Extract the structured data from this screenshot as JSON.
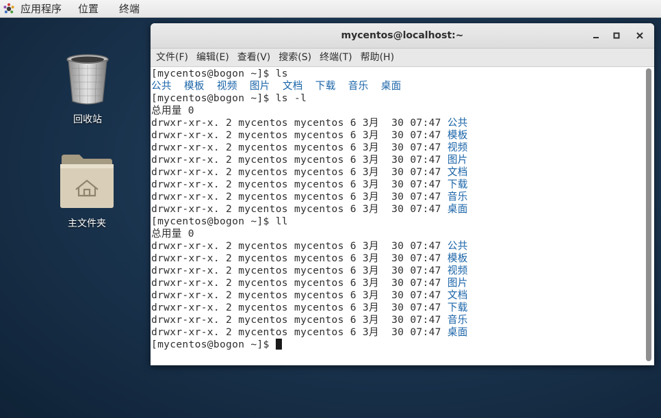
{
  "top_panel": {
    "applications_label": "应用程序",
    "places_label": "位置",
    "terminal_label": "终端",
    "apps_icon": "gnome-foot-icon"
  },
  "desktop": {
    "trash": {
      "label": "回收站",
      "icon": "trash-icon"
    },
    "home": {
      "label": "主文件夹",
      "icon": "home-folder-icon"
    }
  },
  "window": {
    "title": "mycentos@localhost:~",
    "controls": {
      "minimize": "minimize-icon",
      "maximize": "maximize-icon",
      "close": "close-icon"
    }
  },
  "menubar": {
    "items": [
      "文件(F)",
      "编辑(E)",
      "查看(V)",
      "搜索(S)",
      "终端(T)",
      "帮助(H)"
    ]
  },
  "colors": {
    "directory_blue": "#1a64a8",
    "terminal_text": "#2e2e2e",
    "terminal_bg": "#ffffff"
  },
  "terminal": {
    "lines": [
      [
        {
          "text": "[mycentos@bogon ~]$ ls"
        }
      ],
      [
        {
          "text": "公共  模板  视频  图片  文档  下载  音乐  桌面",
          "color": "blue"
        }
      ],
      [
        {
          "text": "[mycentos@bogon ~]$ ls -l"
        }
      ],
      [
        {
          "text": "总用量 0"
        }
      ],
      [
        {
          "text": "drwxr-xr-x. 2 mycentos mycentos 6 3月  30 07:47 "
        },
        {
          "text": "公共",
          "color": "blue"
        }
      ],
      [
        {
          "text": "drwxr-xr-x. 2 mycentos mycentos 6 3月  30 07:47 "
        },
        {
          "text": "模板",
          "color": "blue"
        }
      ],
      [
        {
          "text": "drwxr-xr-x. 2 mycentos mycentos 6 3月  30 07:47 "
        },
        {
          "text": "视频",
          "color": "blue"
        }
      ],
      [
        {
          "text": "drwxr-xr-x. 2 mycentos mycentos 6 3月  30 07:47 "
        },
        {
          "text": "图片",
          "color": "blue"
        }
      ],
      [
        {
          "text": "drwxr-xr-x. 2 mycentos mycentos 6 3月  30 07:47 "
        },
        {
          "text": "文档",
          "color": "blue"
        }
      ],
      [
        {
          "text": "drwxr-xr-x. 2 mycentos mycentos 6 3月  30 07:47 "
        },
        {
          "text": "下载",
          "color": "blue"
        }
      ],
      [
        {
          "text": "drwxr-xr-x. 2 mycentos mycentos 6 3月  30 07:47 "
        },
        {
          "text": "音乐",
          "color": "blue"
        }
      ],
      [
        {
          "text": "drwxr-xr-x. 2 mycentos mycentos 6 3月  30 07:47 "
        },
        {
          "text": "桌面",
          "color": "blue"
        }
      ],
      [
        {
          "text": "[mycentos@bogon ~]$ ll"
        }
      ],
      [
        {
          "text": "总用量 0"
        }
      ],
      [
        {
          "text": "drwxr-xr-x. 2 mycentos mycentos 6 3月  30 07:47 "
        },
        {
          "text": "公共",
          "color": "blue"
        }
      ],
      [
        {
          "text": "drwxr-xr-x. 2 mycentos mycentos 6 3月  30 07:47 "
        },
        {
          "text": "模板",
          "color": "blue"
        }
      ],
      [
        {
          "text": "drwxr-xr-x. 2 mycentos mycentos 6 3月  30 07:47 "
        },
        {
          "text": "视频",
          "color": "blue"
        }
      ],
      [
        {
          "text": "drwxr-xr-x. 2 mycentos mycentos 6 3月  30 07:47 "
        },
        {
          "text": "图片",
          "color": "blue"
        }
      ],
      [
        {
          "text": "drwxr-xr-x. 2 mycentos mycentos 6 3月  30 07:47 "
        },
        {
          "text": "文档",
          "color": "blue"
        }
      ],
      [
        {
          "text": "drwxr-xr-x. 2 mycentos mycentos 6 3月  30 07:47 "
        },
        {
          "text": "下载",
          "color": "blue"
        }
      ],
      [
        {
          "text": "drwxr-xr-x. 2 mycentos mycentos 6 3月  30 07:47 "
        },
        {
          "text": "音乐",
          "color": "blue"
        }
      ],
      [
        {
          "text": "drwxr-xr-x. 2 mycentos mycentos 6 3月  30 07:47 "
        },
        {
          "text": "桌面",
          "color": "blue"
        }
      ],
      [
        {
          "text": "[mycentos@bogon ~]$ "
        },
        {
          "cursor": true
        }
      ]
    ]
  }
}
